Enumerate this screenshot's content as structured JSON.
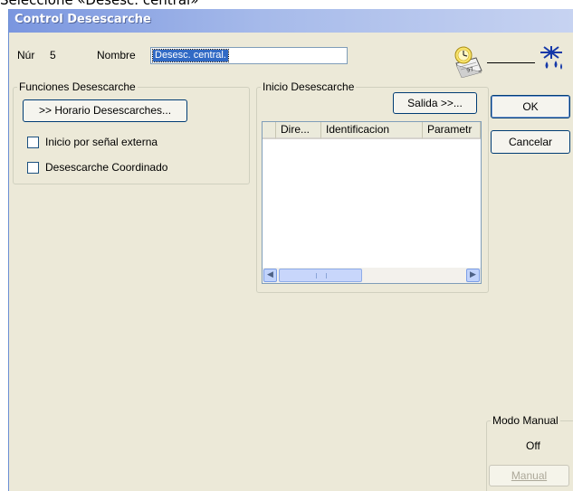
{
  "caption": "Seleccione «Desesc. central»",
  "window": {
    "title": "Control Desescarche"
  },
  "header": {
    "num_label": "Núr",
    "num_value": "5",
    "name_label": "Nombre",
    "name_value": "Desesc. central."
  },
  "funciones": {
    "legend": "Funciones Desescarche",
    "horario_button": ">> Horario Desescarches...",
    "checkbox_inicio_label": "Inicio por señal externa",
    "checkbox_inicio_checked": false,
    "checkbox_coordinado_label": "Desescarche Coordinado",
    "checkbox_coordinado_checked": false
  },
  "inicio": {
    "legend": "Inicio Desescarche",
    "salida_button": "Salida >>...",
    "columns": [
      "",
      "Dire...",
      "Identificacion",
      "Parametr"
    ],
    "rows": []
  },
  "buttons": {
    "ok": "OK",
    "cancel": "Cancelar"
  },
  "manual": {
    "legend": "Modo Manual",
    "status": "Off",
    "button": "Manual",
    "button_enabled": false
  },
  "icons": {
    "clock_schedule": "clock-calendar-icon",
    "defrost": "defrost-snowflake-drops-icon"
  }
}
